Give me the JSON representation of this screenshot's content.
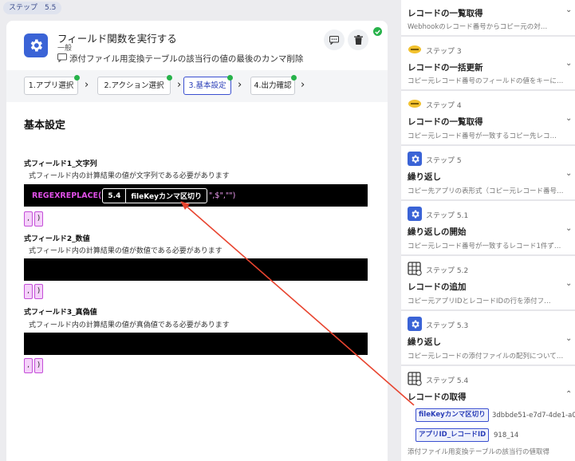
{
  "top_badge": "ステップ　5.5",
  "header": {
    "title": "フィールド関数を実行する",
    "subtitle": "一般",
    "description": "添付ファイル用変換テーブルの該当行の値の最後のカンマ削除"
  },
  "tabs": [
    {
      "label": "1.アプリ選択"
    },
    {
      "label": "2.アクション選択"
    },
    {
      "label": "3.基本設定"
    },
    {
      "label": "4.出力確認"
    }
  ],
  "section_title": "基本設定",
  "fields": [
    {
      "label": "式フィールド1_文字列",
      "hint": "式フィールド内の計算結果の値が文字列である必要があります"
    },
    {
      "label": "式フィールド2_数値",
      "hint": "式フィールド内の計算結果の値が数値である必要があります"
    },
    {
      "label": "式フィールド3_真偽値",
      "hint": "式フィールド内の計算結果の値が真偽値である必要があります"
    }
  ],
  "expression": {
    "function": "REGEXREPLACE(",
    "pill_step": "5.4",
    "pill_label": "fileKeyカンマ区切り",
    "args": "\",$\",\"\")"
  },
  "chips": [
    ",",
    ")"
  ],
  "steps": [
    {
      "title": "レコードの一覧取得",
      "desc": "Webhookのレコード番号からコピー元の対…"
    },
    {
      "step": "ステップ 3",
      "title": "レコードの一括更新",
      "desc": "コピー元レコード番号のフィールドの値をキーに…"
    },
    {
      "step": "ステップ 4",
      "title": "レコードの一覧取得",
      "desc": "コピー元レコード番号が一致するコピー先レコ…"
    },
    {
      "step": "ステップ 5",
      "title": "繰り返し",
      "desc": "コピー先アプリの表形式（コピー元レコード番号…"
    },
    {
      "step": "ステップ 5.1",
      "title": "繰り返しの開始",
      "desc": "コピー元レコード番号が一致するレコード1件ず…"
    },
    {
      "step": "ステップ 5.2",
      "title": "レコードの追加",
      "desc": "コピー元アプリIDとレコードIDの行を添付フ…"
    },
    {
      "step": "ステップ 5.3",
      "title": "繰り返し",
      "desc": "コピー元レコードの添付ファイルの配列について…"
    },
    {
      "step": "ステップ 5.4",
      "title": "レコードの取得",
      "desc": "添付ファイル用変換テーブルの該当行の値取得",
      "outputs": [
        {
          "label": "fileKeyカンマ区切り",
          "value": "3dbbde51-e7d7-4de1-a0"
        },
        {
          "label": "アプリID_レコードID",
          "value": "918_14"
        }
      ]
    }
  ],
  "colors": {
    "accent": "#3a4fd0",
    "gear_tile": "#3a63d6",
    "success": "#27b24a",
    "function_text": "#e050e8",
    "arrow": "#e8442f"
  }
}
